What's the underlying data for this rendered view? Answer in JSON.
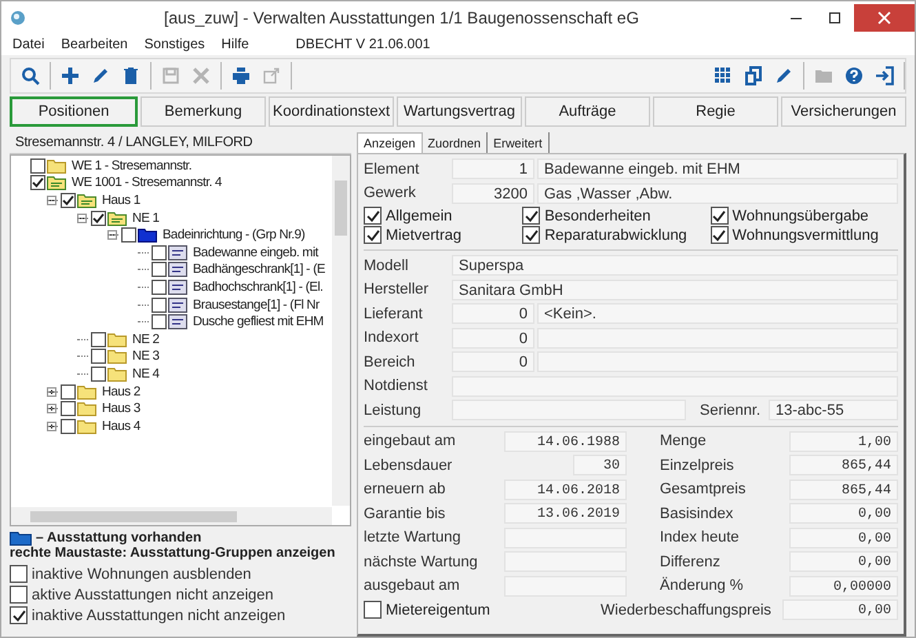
{
  "window": {
    "title": "[aus_zuw] - Verwalten Ausstattungen  1/1  Baugenossenschaft eG"
  },
  "menu": [
    "Datei",
    "Bearbeiten",
    "Sonstiges",
    "Hilfe"
  ],
  "version": "DBECHT V 21.06.001",
  "toolbar": {
    "left": [
      [
        {
          "kind": "search",
          "disabled": false
        }
      ],
      [
        {
          "kind": "add",
          "disabled": false
        },
        {
          "kind": "edit",
          "disabled": false
        },
        {
          "kind": "delete",
          "disabled": false
        }
      ],
      [
        {
          "kind": "save",
          "disabled": true
        },
        {
          "kind": "cancel",
          "disabled": true
        }
      ],
      [
        {
          "kind": "print",
          "disabled": false
        },
        {
          "kind": "export",
          "disabled": true
        }
      ]
    ],
    "right": [
      [
        {
          "kind": "grid",
          "disabled": false
        },
        {
          "kind": "copy",
          "disabled": false
        },
        {
          "kind": "edit",
          "disabled": false
        }
      ],
      [
        {
          "kind": "folder",
          "disabled": true
        },
        {
          "kind": "help",
          "disabled": false
        },
        {
          "kind": "exit",
          "disabled": false
        }
      ]
    ]
  },
  "tabs": [
    {
      "label": "Positionen",
      "selected": true
    },
    {
      "label": "Bemerkung",
      "selected": false
    },
    {
      "label": "Koordinationstext",
      "selected": false
    },
    {
      "label": "Wartungsvertrag",
      "selected": false
    },
    {
      "label": "Aufträge",
      "selected": false
    },
    {
      "label": "Regie",
      "selected": false
    },
    {
      "label": "Versicherungen",
      "selected": false
    }
  ],
  "left": {
    "header": "Stresemannstr. 4 / LANGLEY, MILFORD",
    "tree": [
      {
        "label": "WE 1 - Stresemannstr.",
        "kind": "folder",
        "checked": false
      },
      {
        "label": "WE 1001 - Stresemannstr. 4",
        "kind": "unit",
        "checked": true,
        "children": [
          {
            "label": "Haus 1",
            "kind": "unit",
            "checked": true,
            "expanded": true,
            "children": [
              {
                "label": "NE 1",
                "kind": "unit",
                "checked": true,
                "expanded": true,
                "children": [
                  {
                    "label": "Badeinrichtung - (Grp Nr.9)",
                    "kind": "group",
                    "checked": false,
                    "expanded": true,
                    "children": [
                      {
                        "label": "Badewanne eingeb. mit",
                        "kind": "item",
                        "checked": false
                      },
                      {
                        "label": "Badhängeschrank[1] - (E",
                        "kind": "item",
                        "checked": false
                      },
                      {
                        "label": "Badhochschrank[1] - (El.",
                        "kind": "item",
                        "checked": false
                      },
                      {
                        "label": "Brausestange[1] - (Fl Nr",
                        "kind": "item",
                        "checked": false
                      },
                      {
                        "label": "Dusche gefliest mit EHM",
                        "kind": "item",
                        "checked": false
                      }
                    ]
                  }
                ]
              },
              {
                "label": "NE 2",
                "kind": "folder",
                "checked": false
              },
              {
                "label": "NE 3",
                "kind": "folder",
                "checked": false
              },
              {
                "label": "NE 4",
                "kind": "folder",
                "checked": false
              }
            ]
          },
          {
            "label": "Haus 2",
            "kind": "folder",
            "checked": false,
            "expanded": false
          },
          {
            "label": "Haus 3",
            "kind": "folder",
            "checked": false,
            "expanded": false
          },
          {
            "label": "Haus 4",
            "kind": "folder",
            "checked": false,
            "expanded": false
          }
        ]
      }
    ],
    "legend": [
      "– Ausstattung vorhanden",
      "rechte Maustaste: Ausstattung-Gruppen anzeigen"
    ],
    "options": [
      {
        "label": "inaktive Wohnungen ausblenden",
        "checked": false
      },
      {
        "label": "aktive Ausstattungen nicht anzeigen",
        "checked": false
      },
      {
        "label": "inaktive Ausstattungen nicht anzeigen",
        "checked": true
      }
    ]
  },
  "right": {
    "tabs": [
      {
        "label": "Anzeigen",
        "selected": true
      },
      {
        "label": "Zuordnen",
        "selected": false
      },
      {
        "label": "Erweitert",
        "selected": false
      }
    ],
    "head": [
      {
        "label": "Element",
        "number": "1",
        "value": "Badewanne eingeb. mit EHM"
      },
      {
        "label": "Gewerk",
        "number": "3200",
        "value": "Gas ,Wasser ,Abw."
      }
    ],
    "flags": [
      {
        "label": "Allgemein",
        "checked": true
      },
      {
        "label": "Besonderheiten",
        "checked": true
      },
      {
        "label": "Wohnungsübergabe",
        "checked": true
      },
      {
        "label": "Mietvertrag",
        "checked": true
      },
      {
        "label": "Reparaturabwicklung",
        "checked": true
      },
      {
        "label": "Wohnungsvermittlung",
        "checked": true
      }
    ],
    "fields": [
      {
        "kind": "text",
        "label": "Modell",
        "value": "Superspa"
      },
      {
        "kind": "text",
        "label": "Hersteller",
        "value": "Sanitara GmbH"
      },
      {
        "kind": "coded",
        "label": "Lieferant",
        "number": "0",
        "value": "<Kein>."
      },
      {
        "kind": "coded",
        "label": "Indexort",
        "number": "0"
      },
      {
        "kind": "coded",
        "label": "Bereich",
        "number": "0"
      },
      {
        "kind": "text",
        "label": "Notdienst"
      },
      {
        "kind": "serial",
        "label": "Leistung",
        "sublabel": "Seriennr.",
        "value": "13-abc-55"
      }
    ],
    "dates": [
      {
        "label": "eingebaut am",
        "value": "14.06.1988"
      },
      {
        "label": "Lebensdauer",
        "value": "30",
        "narrow": true
      },
      {
        "label": "erneuern ab",
        "value": "14.06.2018"
      },
      {
        "label": "Garantie bis",
        "value": "13.06.2019"
      },
      {
        "label": "letzte Wartung"
      },
      {
        "label": "nächste Wartung"
      },
      {
        "label": "ausgebaut am"
      }
    ],
    "amounts": [
      {
        "label": "Menge",
        "value": "1,00"
      },
      {
        "label": "Einzelpreis",
        "value": "865,44"
      },
      {
        "label": "Gesamtpreis",
        "value": "865,44"
      },
      {
        "label": "Basisindex",
        "value": "0,00"
      },
      {
        "label": "Index heute",
        "value": "0,00"
      },
      {
        "label": "Differenz",
        "value": "0,00"
      },
      {
        "label": "Änderung %",
        "value": "0,00000"
      }
    ],
    "owner": {
      "label": "Mietereigentum",
      "checked": false
    },
    "replacement": {
      "label": "Wiederbeschaffungspreis",
      "value": "0,00"
    }
  }
}
